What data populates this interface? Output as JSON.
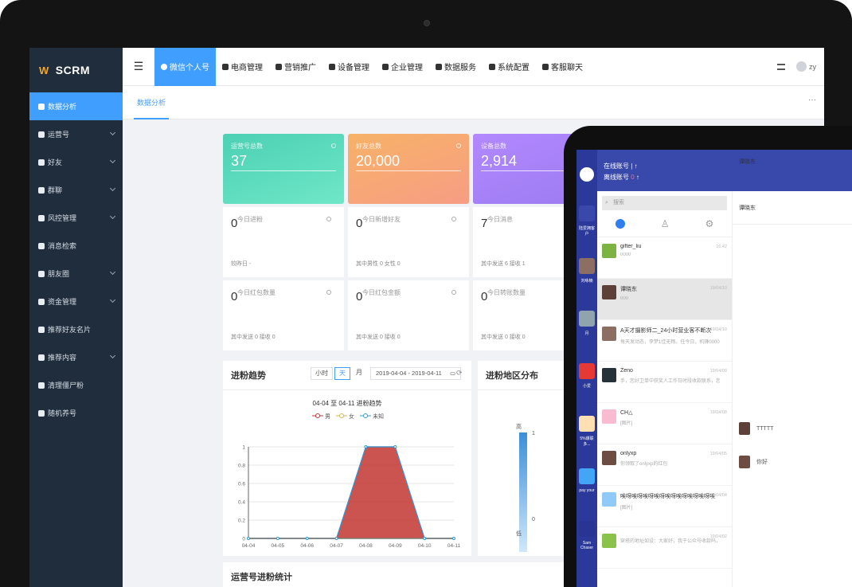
{
  "app": {
    "brand": "SCRM",
    "brand_mark": "W"
  },
  "sidebar": {
    "items": [
      {
        "label": "数据分析",
        "icon": "chart-icon",
        "active": true
      },
      {
        "label": "运营号",
        "icon": "user-icon"
      },
      {
        "label": "好友",
        "icon": "friend-icon"
      },
      {
        "label": "群聊",
        "icon": "group-icon"
      },
      {
        "label": "风控管理",
        "icon": "shield-icon"
      },
      {
        "label": "消息检索",
        "icon": "search-icon"
      },
      {
        "label": "朋友圈",
        "icon": "moments-icon"
      },
      {
        "label": "资金管理",
        "icon": "wallet-icon"
      },
      {
        "label": "推荐好友名片",
        "icon": "card-icon"
      },
      {
        "label": "推荐内容",
        "icon": "content-icon"
      },
      {
        "label": "清理僵尸粉",
        "icon": "clean-icon"
      },
      {
        "label": "随机养号",
        "icon": "random-icon"
      }
    ]
  },
  "topnav": {
    "items": [
      "微信个人号",
      "电商管理",
      "营销推广",
      "设备管理",
      "企业管理",
      "数据服务",
      "系统配置",
      "客服聊天"
    ],
    "user": "zy"
  },
  "tabs": {
    "current": "数据分析",
    "more": "···"
  },
  "stats": [
    {
      "label": "运营号总数",
      "value": "37",
      "color_from": "#4dd0b4",
      "color_to": "#6ee7c7"
    },
    {
      "label": "好友总数",
      "value": "20,000",
      "color_from": "#f7b267",
      "color_to": "#f79d84"
    },
    {
      "label": "设备总数",
      "value": "2,914",
      "color_from": "#b388ff",
      "color_to": "#9c7cf0"
    }
  ],
  "boxes": [
    {
      "label": "今日进粉",
      "value": "0",
      "sub": "较昨日 -"
    },
    {
      "label": "今日新增好友",
      "value": "0",
      "sub": "其中男性 0   女性 0"
    },
    {
      "label": "今日消息",
      "value": "7",
      "sub": "其中发送 6   接收 1"
    },
    {
      "label": "今日红包数量",
      "value": "0",
      "sub": "其中发送 0   接收 0"
    },
    {
      "label": "今日红包金额",
      "value": "0",
      "sub": "其中发送 0   接收 0"
    },
    {
      "label": "今日转账数量",
      "value": "0",
      "sub": "其中发送 0   接收 0"
    }
  ],
  "trend": {
    "title": "进粉趋势",
    "seg": [
      "小时",
      "天",
      "月"
    ],
    "seg_active": "天",
    "date_range": "2019-04-04 - 2019-04-11"
  },
  "region": {
    "title": "进粉地区分布",
    "high": "高",
    "low": "低",
    "max": "1",
    "min": "0",
    "partial": "04"
  },
  "bottom": {
    "title": "运营号进粉统计"
  },
  "chart_data": {
    "type": "area",
    "title": "04-04 至 04-11 进粉趋势",
    "categories": [
      "04-04",
      "04-05",
      "04-06",
      "04-07",
      "04-08",
      "04-09",
      "04-10",
      "04-11"
    ],
    "series": [
      {
        "name": "男",
        "values": [
          0,
          0,
          0,
          0,
          1,
          1,
          0,
          0
        ],
        "color": "#c23531"
      },
      {
        "name": "女",
        "values": [
          0,
          0,
          0,
          0,
          0,
          0,
          0,
          0
        ],
        "color": "#d4b84e"
      },
      {
        "name": "未知",
        "values": [
          0,
          0,
          0,
          0,
          0,
          0,
          0,
          0
        ],
        "color": "#2f9bd6"
      }
    ],
    "yticks": [
      "0",
      "0.2",
      "0.4",
      "0.6",
      "0.8",
      "1"
    ],
    "ylim": [
      0,
      1
    ],
    "grid": true,
    "legend": "top-center"
  },
  "tablet": {
    "online": "在线账号",
    "offline": "离线账号",
    "arrow": "↑",
    "search": "搜索",
    "chat_title": "谭晓东",
    "left_labels": [
      "陆爱拥客户",
      "刘咏楠",
      "月",
      "小爱",
      "5%爆联多...",
      "pay your",
      "Sam Chaser"
    ],
    "chats": [
      {
        "name": "gifter_liu",
        "msg": "0000",
        "time": "16:42",
        "color": "#7cb342"
      },
      {
        "name": "谭晓东",
        "msg": "000",
        "time": "19/04/10",
        "color": "#5d4037",
        "selected": true
      },
      {
        "name": "A天才摄影师二_24小时营业客不断次",
        "msg": "每天发动态，李梦1佳无畅。任今日，机锋00001上收...",
        "time": "19/04/10",
        "color": "#8d6e63"
      },
      {
        "name": "Zeno",
        "msg": "手，您好卫单中获奖人工作日时段收款联系，您是单..",
        "time": "19/04/09",
        "color": "#263238"
      },
      {
        "name": "CH△",
        "msg": "[图片]",
        "time": "19/04/08",
        "color": "#f8bbd0"
      },
      {
        "name": "onlyxp",
        "msg": "你领取了onlyxp的红包",
        "time": "19/04/05",
        "color": "#6d4c41"
      },
      {
        "name": "唉呀唉呀唉呀唉呀唉呀唉呀唉呀唉呀唉",
        "msg": "[图片]",
        "time": "19/04/04",
        "color": "#90caf9"
      },
      {
        "name": "",
        "msg": "穿搭的地址如设：大家好，我于公众号收款吗，抢领取",
        "time": "19/04/02",
        "color": "#8bc34a"
      }
    ],
    "side_messages": [
      "TTTTT",
      "你好"
    ]
  }
}
